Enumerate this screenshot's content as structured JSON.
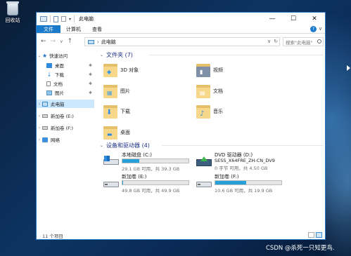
{
  "desktop": {
    "recycle_bin_label": "回收站",
    "watermark": "CSDN @杀死一只知更鸟."
  },
  "window": {
    "title": "此电脑",
    "quick_access_dropdown": "▾",
    "controls": {
      "minimize": "—",
      "maximize": "☐",
      "close": "✕"
    }
  },
  "ribbon": {
    "tabs": [
      "文件",
      "计算机",
      "查看"
    ],
    "expand": "∨",
    "help": "?"
  },
  "address": {
    "back": "←",
    "forward": "→",
    "recent": "∨",
    "up": "↑",
    "chevron": "›",
    "path": "此电脑",
    "dropdown": "∨",
    "refresh": "↻",
    "search_placeholder": "搜索\"此电脑\""
  },
  "sidebar": {
    "quick_access": "快速访问",
    "quick_items": [
      "桌面",
      "下载",
      "文档",
      "图片"
    ],
    "pin": "✱",
    "this_pc": "此电脑",
    "drives": [
      "新加卷 (E:)",
      "新加卷 (F:)"
    ],
    "network": "网络"
  },
  "folders": {
    "header": "文件夹 (7)",
    "items": [
      {
        "name": "3D 对象",
        "icon": "3d-objects-icon"
      },
      {
        "name": "视频",
        "icon": "videos-icon"
      },
      {
        "name": "图片",
        "icon": "pictures-icon"
      },
      {
        "name": "文档",
        "icon": "documents-icon"
      },
      {
        "name": "下载",
        "icon": "downloads-icon"
      },
      {
        "name": "音乐",
        "icon": "music-icon"
      },
      {
        "name": "桌面",
        "icon": "desktop-icon"
      }
    ]
  },
  "devices": {
    "header": "设备和驱动器 (4)",
    "items": [
      {
        "name": "本地磁盘 (C:)",
        "free": "29.1 GB 可用，共 39.3 GB",
        "used_fraction": 0.26,
        "icon": "system-drive-icon"
      },
      {
        "name": "DVD 驱动器 (D:)",
        "label": "SESS_X64FRE_ZH-CN_DV9",
        "free": "0 字节 可用，共 4.50 GB",
        "icon": "dvd-drive-icon"
      },
      {
        "name": "新加卷 (E:)",
        "free": "49.8 GB 可用，共 49.9 GB",
        "used_fraction": 0.01,
        "icon": "drive-icon"
      },
      {
        "name": "新加卷 (F:)",
        "free": "10.6 GB 可用，共 19.9 GB",
        "used_fraction": 0.47,
        "icon": "drive-icon"
      }
    ]
  },
  "status": {
    "item_count": "11 个项目"
  },
  "colors": {
    "accent": "#1979ca",
    "drive_bar": "#26a0da",
    "selection": "#cce8ff",
    "group_header": "#1e3287"
  }
}
